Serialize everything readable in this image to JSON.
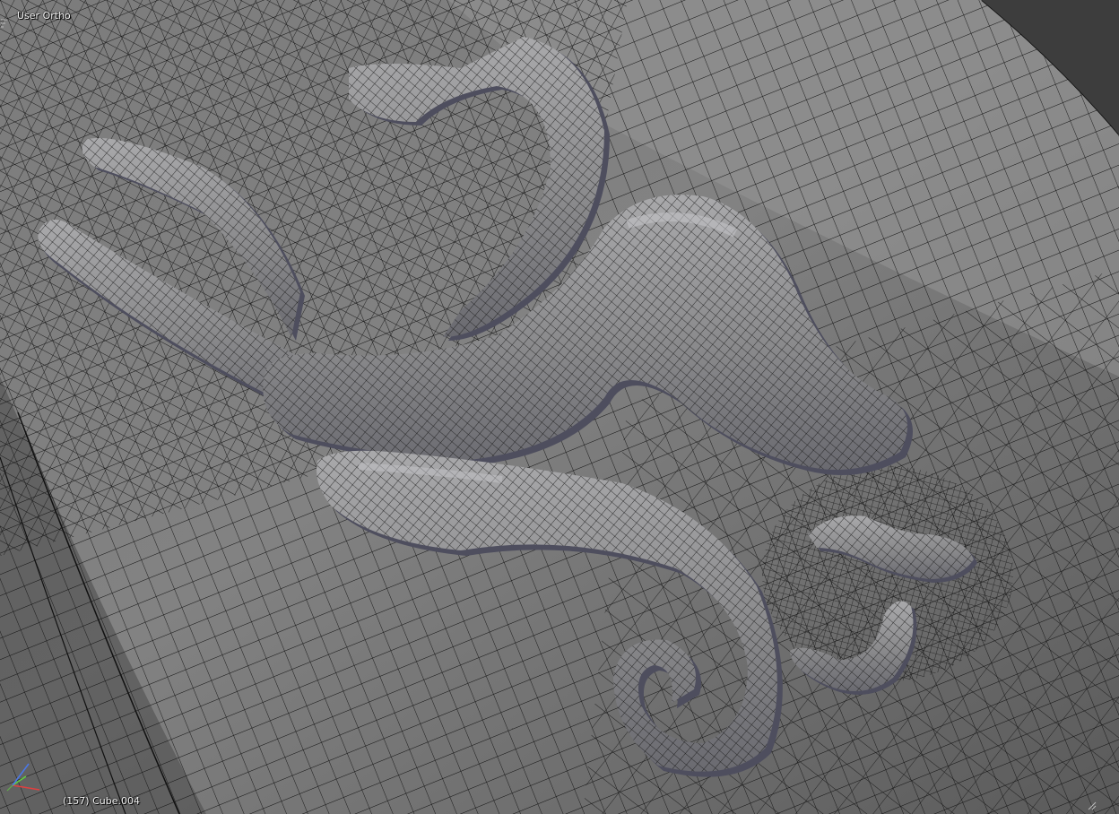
{
  "viewport": {
    "view_label": "User Ortho",
    "object_label": "(157) Cube.004",
    "editor": "3D Viewport",
    "shading": "solid-wireframe"
  },
  "colors": {
    "background_corner": "#3d3d3d",
    "surface_light": "#8c8c8c",
    "surface_dark": "#585858",
    "wire": "#0a0a0a",
    "tube_light": "#a4a4a6",
    "tube_shadow": "#505062",
    "axis_x": "#e04040",
    "axis_y": "#60d040",
    "axis_z": "#4a78e8",
    "overlay_text": "#f2f2f2"
  },
  "icons": {
    "axis_gizmo": "xyz-axis-icon",
    "corner_split_top_left": "corner-split-icon",
    "corner_split_bottom_right": "corner-split-icon"
  }
}
